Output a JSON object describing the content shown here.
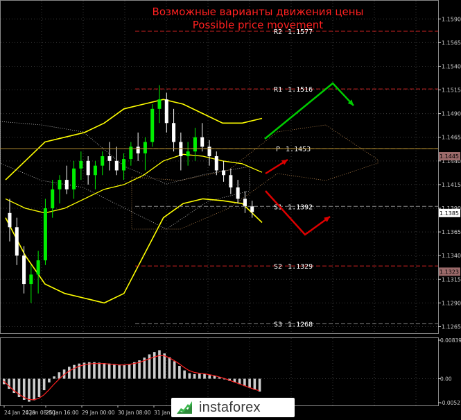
{
  "chart_data": [
    {
      "type": "candlestick",
      "title": "Возможные варианты движения цены",
      "subtitle": "Possible price movement",
      "y_ticks": [
        "1.1590",
        "1.1565",
        "1.1540",
        "1.1515",
        "1.1490",
        "1.1465",
        "1.1440",
        "1.1415",
        "1.1390",
        "1.1365",
        "1.1340",
        "1.1315",
        "1.1290",
        "1.1265"
      ],
      "ylim": [
        1.1258,
        1.161
      ],
      "x_ticks": [
        "24 Jan 2020",
        "24 Jan 08:00",
        "25 Jan 16:00",
        "29 Jan 00:00",
        "30 Jan 08:00",
        "31 Jan"
      ],
      "current_price_labels": [
        "1.1445",
        "1.1385",
        "1.1323"
      ],
      "levels": [
        {
          "label": "R2",
          "value": "1.1577",
          "color": "#cc2222"
        },
        {
          "label": "R1",
          "value": "1.1516",
          "color": "#cc2222"
        },
        {
          "label": "P",
          "value": "1.1453",
          "color": "#b08a30"
        },
        {
          "label": "S1",
          "value": "1.1392",
          "color": "#888888"
        },
        {
          "label": "S2",
          "value": "1.1329",
          "color": "#cc2222"
        },
        {
          "label": "S3",
          "value": "1.1268",
          "color": "#888888"
        }
      ],
      "candles": [
        [
          1.1385,
          1.14,
          1.1355,
          1.137
        ],
        [
          1.137,
          1.138,
          1.133,
          1.134
        ],
        [
          1.134,
          1.135,
          1.13,
          1.131
        ],
        [
          1.131,
          1.133,
          1.129,
          1.132
        ],
        [
          1.132,
          1.1345,
          1.13,
          1.1335
        ],
        [
          1.1335,
          1.14,
          1.133,
          1.139
        ],
        [
          1.139,
          1.142,
          1.138,
          1.141
        ],
        [
          1.141,
          1.1425,
          1.1395,
          1.142
        ],
        [
          1.142,
          1.1435,
          1.1405,
          1.141
        ],
        [
          1.141,
          1.144,
          1.14,
          1.1432
        ],
        [
          1.1432,
          1.145,
          1.142,
          1.144
        ],
        [
          1.144,
          1.1445,
          1.1415,
          1.1425
        ],
        [
          1.1425,
          1.144,
          1.141,
          1.1435
        ],
        [
          1.1435,
          1.145,
          1.1425,
          1.1445
        ],
        [
          1.1445,
          1.146,
          1.143,
          1.144
        ],
        [
          1.144,
          1.1455,
          1.1425,
          1.143
        ],
        [
          1.143,
          1.1448,
          1.142,
          1.1442
        ],
        [
          1.1442,
          1.146,
          1.1435,
          1.1455
        ],
        [
          1.1455,
          1.147,
          1.144,
          1.1448
        ],
        [
          1.1448,
          1.1465,
          1.143,
          1.146
        ],
        [
          1.146,
          1.15,
          1.1455,
          1.1495
        ],
        [
          1.1495,
          1.152,
          1.148,
          1.1505
        ],
        [
          1.1505,
          1.1512,
          1.147,
          1.148
        ],
        [
          1.148,
          1.1495,
          1.145,
          1.146
        ],
        [
          1.146,
          1.147,
          1.143,
          1.1445
        ],
        [
          1.1445,
          1.146,
          1.1435,
          1.145
        ],
        [
          1.145,
          1.1475,
          1.144,
          1.1465
        ],
        [
          1.1465,
          1.148,
          1.145,
          1.1455
        ],
        [
          1.1455,
          1.1462,
          1.1435,
          1.1445
        ],
        [
          1.1445,
          1.145,
          1.1425,
          1.143
        ],
        [
          1.143,
          1.144,
          1.1418,
          1.1425
        ],
        [
          1.1425,
          1.1432,
          1.1405,
          1.1412
        ],
        [
          1.1412,
          1.142,
          1.1395,
          1.14
        ],
        [
          1.14,
          1.1408,
          1.1385,
          1.1392
        ],
        [
          1.1392,
          1.1398,
          1.138,
          1.1386
        ]
      ],
      "bollinger_upper": [
        1.142,
        1.144,
        1.146,
        1.1465,
        1.147,
        1.148,
        1.1495,
        1.15,
        1.1505,
        1.15,
        1.149,
        1.148,
        1.148,
        1.1485
      ],
      "bollinger_lower": [
        1.138,
        1.134,
        1.131,
        1.13,
        1.1295,
        1.129,
        1.13,
        1.134,
        1.138,
        1.1395,
        1.14,
        1.1398,
        1.1395,
        1.1375
      ],
      "bollinger_mid": [
        1.14,
        1.139,
        1.1385,
        1.139,
        1.14,
        1.141,
        1.1415,
        1.1425,
        1.144,
        1.1447,
        1.1445,
        1.144,
        1.1437,
        1.1428
      ]
    },
    {
      "type": "bar",
      "title": "MACD",
      "y_ticks": [
        "0.00839",
        "0.00",
        "-0.00521"
      ],
      "ylim": [
        -0.00521,
        0.00839
      ],
      "histogram": [
        -0.0012,
        -0.0022,
        -0.0031,
        -0.004,
        -0.0046,
        -0.005,
        -0.0047,
        -0.004,
        -0.0025,
        -0.0008,
        0.0005,
        0.0014,
        0.002,
        0.0026,
        0.003,
        0.0033,
        0.0035,
        0.0036,
        0.0036,
        0.0035,
        0.0034,
        0.0033,
        0.0032,
        0.0031,
        0.003,
        0.0032,
        0.0036,
        0.004,
        0.0046,
        0.0053,
        0.0058,
        0.0062,
        0.0055,
        0.0047,
        0.0038,
        0.0028,
        0.0018,
        0.0012,
        0.001,
        0.0011,
        0.001,
        0.0008,
        0.0006,
        0.0003,
        -0.0001,
        -0.0005,
        -0.0008,
        -0.0012,
        -0.0016,
        -0.002,
        -0.0024,
        -0.0028
      ],
      "signal": [
        -0.0005,
        -0.0015,
        -0.0025,
        -0.0033,
        -0.004,
        -0.0045,
        -0.0046,
        -0.0043,
        -0.0036,
        -0.0025,
        -0.0013,
        -0.0002,
        0.0008,
        0.0016,
        0.0022,
        0.0027,
        0.003,
        0.0032,
        0.0033,
        0.0033,
        0.0033,
        0.0032,
        0.0031,
        0.003,
        0.003,
        0.0031,
        0.0033,
        0.0035,
        0.0039,
        0.0043,
        0.0047,
        0.005,
        0.005,
        0.0046,
        0.004,
        0.0033,
        0.0025,
        0.0018,
        0.0014,
        0.0012,
        0.0011,
        0.0009,
        0.0007,
        0.0004,
        0.0001,
        -0.0003,
        -0.0007,
        -0.0011,
        -0.0015,
        -0.0019,
        -0.0023,
        -0.0026
      ]
    }
  ],
  "brand": {
    "name": "instaforex"
  },
  "colors": {
    "bull": "#00ee00",
    "bear": "#ffffff",
    "grid": "#3a3a3a",
    "axis": "#cccccc",
    "title": "#ff2020",
    "bollinger": "#ffff00",
    "arrow_up": "#00cc00",
    "arrow_down": "#dd0000",
    "pivot": "#b08a30",
    "macd_hist": "#cccccc",
    "macd_signal": "#ff2020"
  }
}
